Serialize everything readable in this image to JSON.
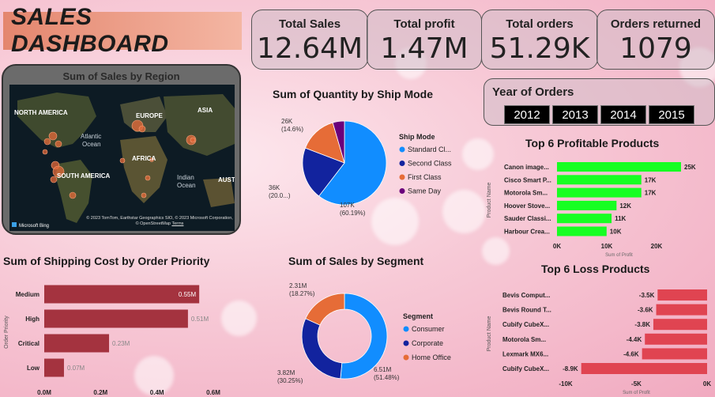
{
  "dashboard": {
    "title": "SALES DASHBOARD"
  },
  "kpis": [
    {
      "label": "Total Sales",
      "value": "12.64M"
    },
    {
      "label": "Total profit",
      "value": "1.47M"
    },
    {
      "label": "Total orders",
      "value": "51.29K"
    },
    {
      "label": "Orders returned",
      "value": "1079"
    }
  ],
  "map": {
    "title": "Sum of Sales by Region",
    "labels": [
      "NORTH AMERICA",
      "EUROPE",
      "ASIA",
      "Atlantic",
      "Ocean",
      "AFRICA",
      "SOUTH AMERICA",
      "Indian",
      "Ocean",
      "AUSTR"
    ],
    "brand": "Microsoft Bing",
    "copyright": "© 2023 TomTom, Earthstar Geographics SIO, © 2023 Microsoft Corporation, © OpenStreetMap",
    "terms": "Terms"
  },
  "year_slicer": {
    "label": "Year of Orders",
    "years": [
      "2012",
      "2013",
      "2014",
      "2015"
    ]
  },
  "chart_data": [
    {
      "type": "pie",
      "title": "Sum of Quantity by Ship Mode",
      "legend_title": "Ship Mode",
      "legend_position": "right",
      "categories": [
        "Standard Cl...",
        "Second Class",
        "First Class",
        "Same Day"
      ],
      "values": [
        107000,
        36000,
        26000,
        8000
      ],
      "colors": [
        "#118dff",
        "#12239e",
        "#e66c37",
        "#6b007b"
      ],
      "data_labels": [
        "107K\n(60.19%)",
        "36K\n(20.0...)",
        "26K\n(14.6%)",
        ""
      ]
    },
    {
      "type": "bar",
      "orientation": "horizontal",
      "title": "Top 6 Profitable Products",
      "ylabel": "Product Name",
      "xlabel": "Sum of Profit",
      "categories": [
        "Canon image...",
        "Cisco Smart P...",
        "Motorola Sm...",
        "Hoover Stove...",
        "Sauder Classi...",
        "Harbour Crea..."
      ],
      "values": [
        25000,
        17000,
        17000,
        12000,
        11000,
        10000
      ],
      "data_labels": [
        "25K",
        "17K",
        "17K",
        "12K",
        "11K",
        "10K"
      ],
      "xticks": [
        "0K",
        "10K",
        "20K"
      ],
      "xlim": [
        0,
        25000
      ],
      "color": "#17ff22"
    },
    {
      "type": "bar",
      "orientation": "horizontal",
      "title": "Sum of Shipping Cost by Order Priority",
      "ylabel": "Order Priority",
      "categories": [
        "Medium",
        "High",
        "Critical",
        "Low"
      ],
      "values": [
        0.55,
        0.51,
        0.23,
        0.07
      ],
      "data_labels": [
        "0.55M",
        "0.51M",
        "0.23M",
        "0.07M"
      ],
      "xticks": [
        "0.0M",
        "0.2M",
        "0.4M",
        "0.6M"
      ],
      "xlim": [
        0,
        0.6
      ],
      "color": "#a4333f"
    },
    {
      "type": "pie",
      "subtype": "donut",
      "title": "Sum of Sales by Segment",
      "legend_title": "Segment",
      "legend_position": "right",
      "categories": [
        "Consumer",
        "Corporate",
        "Home Office"
      ],
      "values": [
        6.51,
        3.82,
        2.31
      ],
      "colors": [
        "#118dff",
        "#12239e",
        "#e66c37"
      ],
      "data_labels": [
        "6.51M\n(51.48%)",
        "3.82M\n(30.25%)",
        "2.31M\n(18.27%)"
      ]
    },
    {
      "type": "bar",
      "orientation": "horizontal",
      "title": "Top 6 Loss Products",
      "ylabel": "Product Name",
      "xlabel": "Sum of Profit",
      "categories": [
        "Bevis Comput...",
        "Bevis Round T...",
        "Cubify CubeX...",
        "Motorola Sm...",
        "Lexmark MX6...",
        "Cubify CubeX..."
      ],
      "values": [
        -3500,
        -3600,
        -3800,
        -4400,
        -4600,
        -8900
      ],
      "data_labels": [
        "-3.5K",
        "-3.6K",
        "-3.8K",
        "-4.4K",
        "-4.6K",
        "-8.9K"
      ],
      "xticks": [
        "-10K",
        "-5K",
        "0K"
      ],
      "xlim": [
        -10000,
        0
      ],
      "color": "#e04451"
    }
  ]
}
